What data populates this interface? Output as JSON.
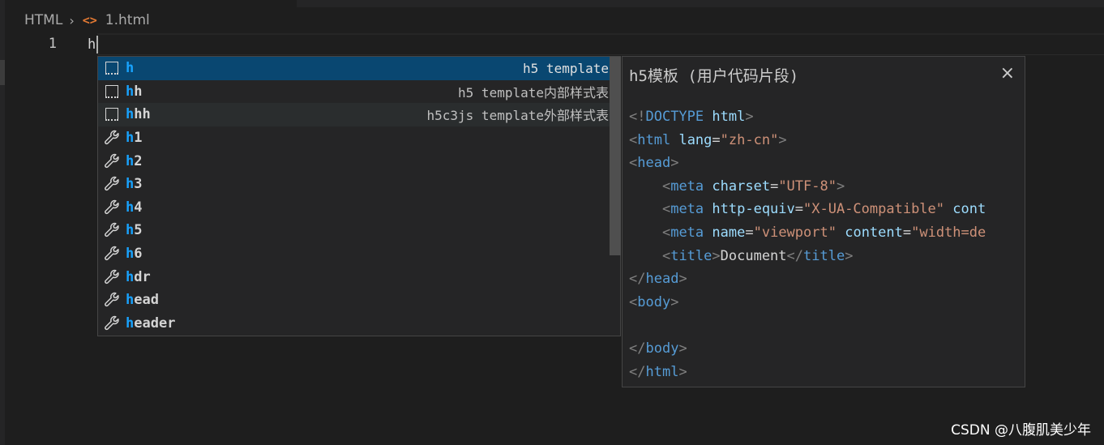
{
  "breadcrumb": {
    "language": "HTML",
    "file_icon": "<>",
    "file": "1.html"
  },
  "editor": {
    "line_number": "1",
    "typed_text": "h"
  },
  "suggestions": [
    {
      "match": "h",
      "rest": "",
      "detail": "h5 template",
      "kind": "snippet-icon",
      "state": "selected"
    },
    {
      "match": "h",
      "rest": "h",
      "detail": "h5 template内部样式表",
      "kind": "snippet-icon",
      "state": ""
    },
    {
      "match": "h",
      "rest": "hh",
      "detail": "h5c3js template外部样式表",
      "kind": "snippet-icon",
      "state": "hover"
    },
    {
      "match": "h",
      "rest": "1",
      "detail": "",
      "kind": "wrench-icon",
      "state": ""
    },
    {
      "match": "h",
      "rest": "2",
      "detail": "",
      "kind": "wrench-icon",
      "state": ""
    },
    {
      "match": "h",
      "rest": "3",
      "detail": "",
      "kind": "wrench-icon",
      "state": ""
    },
    {
      "match": "h",
      "rest": "4",
      "detail": "",
      "kind": "wrench-icon",
      "state": ""
    },
    {
      "match": "h",
      "rest": "5",
      "detail": "",
      "kind": "wrench-icon",
      "state": ""
    },
    {
      "match": "h",
      "rest": "6",
      "detail": "",
      "kind": "wrench-icon",
      "state": ""
    },
    {
      "match": "h",
      "rest": "dr",
      "detail": "",
      "kind": "wrench-icon",
      "state": ""
    },
    {
      "match": "h",
      "rest": "ead",
      "detail": "",
      "kind": "wrench-icon",
      "state": ""
    },
    {
      "match": "h",
      "rest": "eader",
      "detail": "",
      "kind": "wrench-icon",
      "state": ""
    }
  ],
  "doc": {
    "title": "h5模板 (用户代码片段)",
    "close": "×",
    "code_lines": [
      [
        [
          "p",
          "<!"
        ],
        [
          "t",
          "DOCTYPE"
        ],
        [
          "x",
          " "
        ],
        [
          "a",
          "html"
        ],
        [
          "p",
          ">"
        ]
      ],
      [
        [
          "p",
          "<"
        ],
        [
          "t",
          "html"
        ],
        [
          "x",
          " "
        ],
        [
          "a",
          "lang"
        ],
        [
          "x",
          "="
        ],
        [
          "s",
          "\"zh-cn\""
        ],
        [
          "p",
          ">"
        ]
      ],
      [
        [
          "p",
          "<"
        ],
        [
          "t",
          "head"
        ],
        [
          "p",
          ">"
        ]
      ],
      [
        [
          "x",
          "    "
        ],
        [
          "p",
          "<"
        ],
        [
          "t",
          "meta"
        ],
        [
          "x",
          " "
        ],
        [
          "a",
          "charset"
        ],
        [
          "x",
          "="
        ],
        [
          "s",
          "\"UTF-8\""
        ],
        [
          "p",
          ">"
        ]
      ],
      [
        [
          "x",
          "    "
        ],
        [
          "p",
          "<"
        ],
        [
          "t",
          "meta"
        ],
        [
          "x",
          " "
        ],
        [
          "a",
          "http-equiv"
        ],
        [
          "x",
          "="
        ],
        [
          "s",
          "\"X-UA-Compatible\""
        ],
        [
          "x",
          " "
        ],
        [
          "a",
          "cont"
        ]
      ],
      [
        [
          "x",
          "    "
        ],
        [
          "p",
          "<"
        ],
        [
          "t",
          "meta"
        ],
        [
          "x",
          " "
        ],
        [
          "a",
          "name"
        ],
        [
          "x",
          "="
        ],
        [
          "s",
          "\"viewport\""
        ],
        [
          "x",
          " "
        ],
        [
          "a",
          "content"
        ],
        [
          "x",
          "="
        ],
        [
          "s",
          "\"width=de"
        ]
      ],
      [
        [
          "x",
          "    "
        ],
        [
          "p",
          "<"
        ],
        [
          "t",
          "title"
        ],
        [
          "p",
          ">"
        ],
        [
          "x",
          "Document"
        ],
        [
          "p",
          "</"
        ],
        [
          "t",
          "title"
        ],
        [
          "p",
          ">"
        ]
      ],
      [
        [
          "p",
          "</"
        ],
        [
          "t",
          "head"
        ],
        [
          "p",
          ">"
        ]
      ],
      [
        [
          "p",
          "<"
        ],
        [
          "t",
          "body"
        ],
        [
          "p",
          ">"
        ]
      ],
      [],
      [
        [
          "p",
          "</"
        ],
        [
          "t",
          "body"
        ],
        [
          "p",
          ">"
        ]
      ],
      [
        [
          "p",
          "</"
        ],
        [
          "t",
          "html"
        ],
        [
          "p",
          ">"
        ]
      ]
    ]
  },
  "watermark": "CSDN @八腹肌美少年",
  "colors": {
    "selected_row": "#094771",
    "match_highlight": "#18a3ff",
    "tag": "#569cd6",
    "attribute": "#9cdcfe",
    "string": "#ce9178",
    "file_icon": "#e37933"
  }
}
